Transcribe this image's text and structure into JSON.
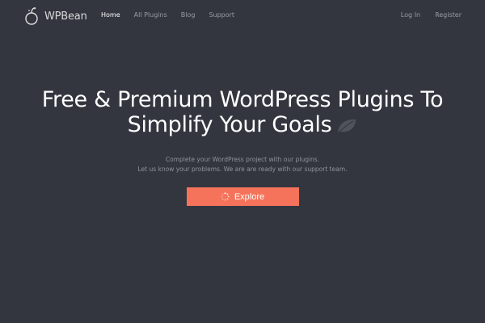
{
  "brand": {
    "name": "WPBean",
    "logo_icon": "apple-logo-icon"
  },
  "nav": {
    "items": [
      {
        "label": "Home",
        "active": true
      },
      {
        "label": "All Plugins",
        "active": false
      },
      {
        "label": "Blog",
        "active": false
      },
      {
        "label": "Support",
        "active": false
      }
    ]
  },
  "auth": {
    "login_label": "Log In",
    "register_label": "Register"
  },
  "hero": {
    "headline_line1": "Free & Premium WordPress Plugins To",
    "headline_line2": "Simplify Your Goals",
    "headline_icon": "leaf-icon",
    "sub_line1": "Complete your WordPress project with our plugins.",
    "sub_line2": "Let us know your problems. We are are ready with our support team.",
    "cta_label": "Explore",
    "cta_icon": "spinner-icon"
  },
  "colors": {
    "background": "#33363f",
    "accent": "#f6735b",
    "text_primary": "#ffffff",
    "text_muted": "#8f929a"
  }
}
